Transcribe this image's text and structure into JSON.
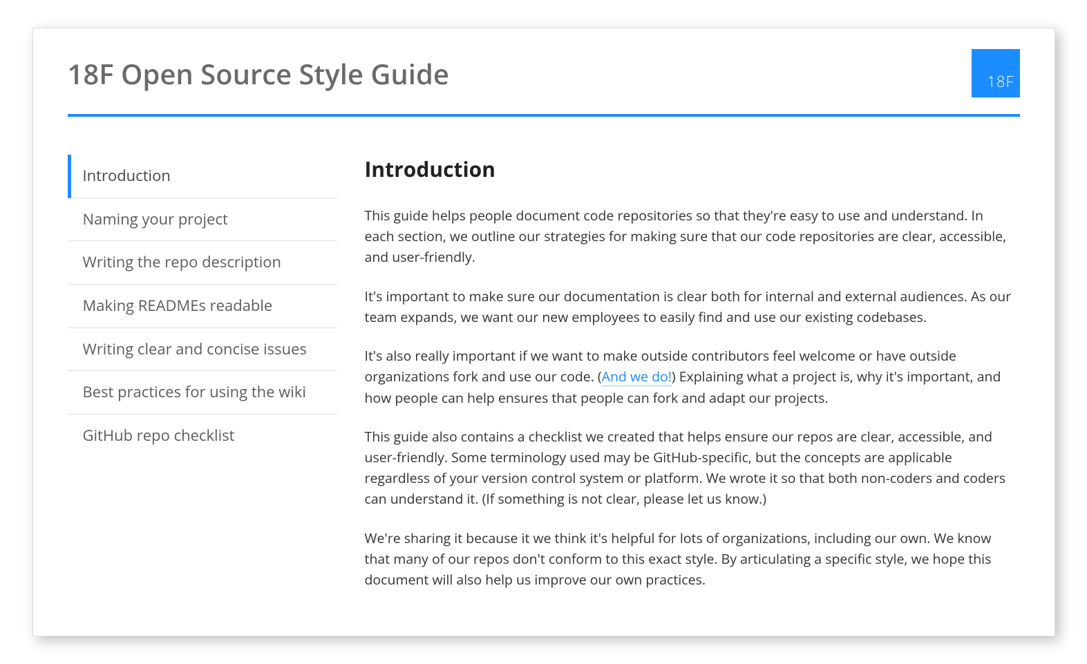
{
  "header": {
    "site_title": "18F Open Source Style Guide",
    "logo_text": "18F"
  },
  "sidebar": {
    "items": [
      {
        "label": "Introduction",
        "active": true
      },
      {
        "label": "Naming your project",
        "active": false
      },
      {
        "label": "Writing the repo description",
        "active": false
      },
      {
        "label": "Making READMEs readable",
        "active": false
      },
      {
        "label": "Writing clear and concise issues",
        "active": false
      },
      {
        "label": "Best practices for using the wiki",
        "active": false
      },
      {
        "label": "GitHub repo checklist",
        "active": false
      }
    ]
  },
  "content": {
    "heading": "Introduction",
    "p1": "This guide helps people document code repositories so that they're easy to use and understand. In each section, we outline our strategies for making sure that our code repositories are clear, accessible, and user-friendly.",
    "p2": "It's important to make sure our documentation is clear both for internal and external audiences. As our team expands, we want our new employees to easily find and use our existing codebases.",
    "p3a": "It's also really important if we want to make outside contributors feel welcome or have outside organizations fork and use our code. (",
    "p3_link": "And we do!",
    "p3b": ") Explaining what a project is, why it's important, and how people can help ensures that people can fork and adapt our projects.",
    "p4": "This guide also contains a checklist we created that helps ensure our repos are clear, accessible, and user-friendly. Some terminology used may be GitHub-specific, but the concepts are applicable regardless of your version control system or platform. We wrote it so that both non-coders and coders can understand it. (If something is not clear, please let us know.)",
    "p5": "We're sharing it because it we think it's helpful for lots of organizations, including our own. We know that many of our repos don't conform to this exact style. By articulating a specific style, we hope this document will also help us improve our own practices."
  }
}
